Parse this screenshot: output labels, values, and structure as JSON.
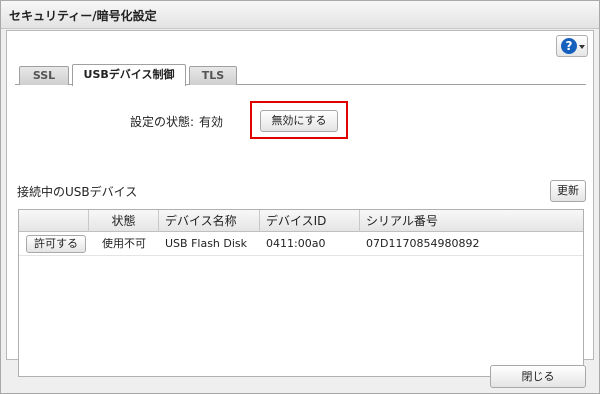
{
  "window": {
    "title": "セキュリティー/暗号化設定"
  },
  "help": {
    "icon": "help-icon",
    "glyph": "?"
  },
  "tabs": [
    {
      "label": "SSL",
      "active": false
    },
    {
      "label": "USBデバイス制御",
      "active": true
    },
    {
      "label": "TLS",
      "active": false
    }
  ],
  "usb_control": {
    "status_label": "設定の状態:",
    "status_value": "有効",
    "disable_button": "無効にする",
    "devices_title": "接続中のUSBデバイス",
    "refresh_button": "更新",
    "columns": [
      "",
      "状態",
      "デバイス名称",
      "デバイスID",
      "シリアル番号"
    ],
    "rows": [
      {
        "action": "許可する",
        "status": "使用不可",
        "device_name": "USB Flash Disk",
        "device_id": "0411:00a0",
        "serial": "07D1170854980892"
      }
    ]
  },
  "footer": {
    "close_button": "閉じる"
  },
  "colors": {
    "highlight": "#e00000",
    "help_accent": "#1560bd"
  }
}
